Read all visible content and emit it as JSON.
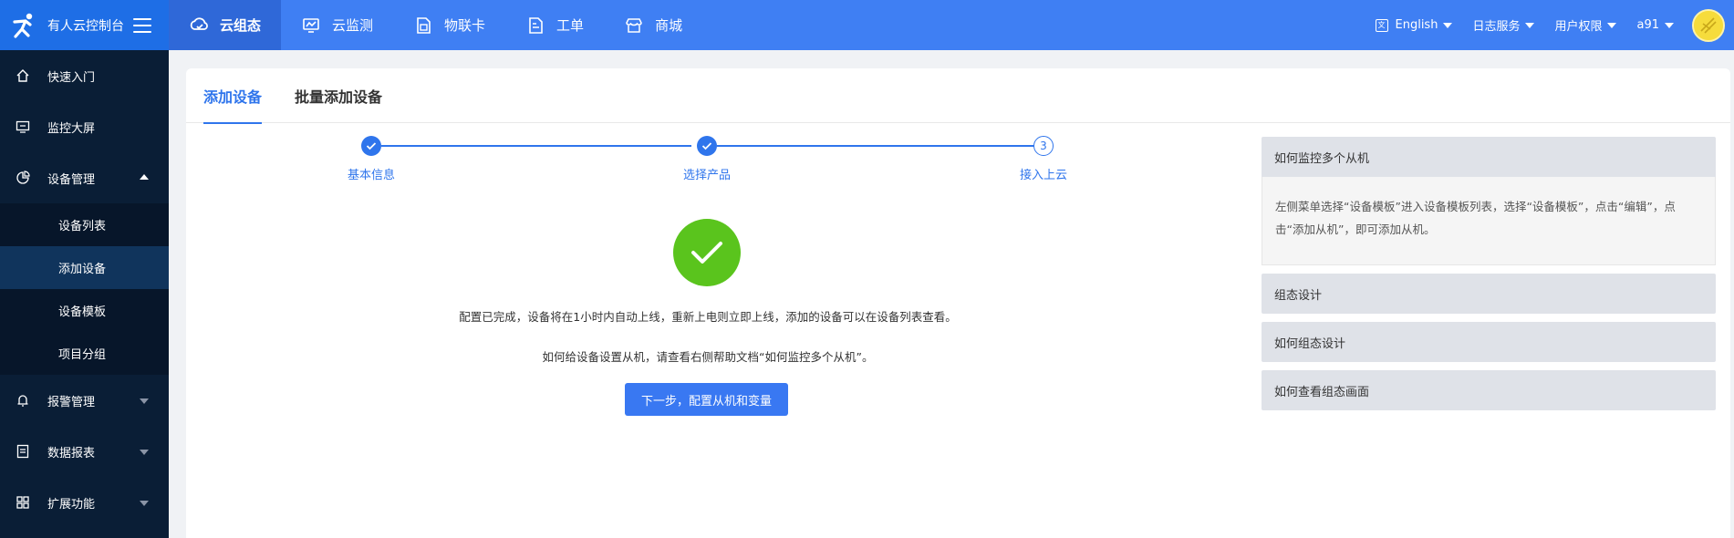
{
  "app": {
    "title": "有人云控制台"
  },
  "topnav": [
    {
      "label": "云组态",
      "icon": "cloud-icon",
      "active": true
    },
    {
      "label": "云监测",
      "icon": "monitor-chart-icon",
      "active": false
    },
    {
      "label": "物联卡",
      "icon": "sim-card-icon",
      "active": false
    },
    {
      "label": "工单",
      "icon": "ticket-icon",
      "active": false
    },
    {
      "label": "商城",
      "icon": "shop-icon",
      "active": false
    }
  ],
  "topright": {
    "language": "English",
    "log_service": "日志服务",
    "user_permissions": "用户权限",
    "username": "a91"
  },
  "sidebar": {
    "items": [
      {
        "label": "快速入门",
        "icon": "home-icon"
      },
      {
        "label": "监控大屏",
        "icon": "screen-icon"
      },
      {
        "label": "设备管理",
        "icon": "device-icon"
      },
      {
        "label": "报警管理",
        "icon": "bell-icon"
      },
      {
        "label": "数据报表",
        "icon": "report-icon"
      },
      {
        "label": "扩展功能",
        "icon": "grid-icon"
      }
    ],
    "sub_items": [
      "设备列表",
      "添加设备",
      "设备模板",
      "项目分组"
    ],
    "active_sub": "添加设备"
  },
  "tabs": [
    "添加设备",
    "批量添加设备"
  ],
  "steps": [
    {
      "label": "基本信息",
      "state": "done"
    },
    {
      "label": "选择产品",
      "state": "done"
    },
    {
      "label": "接入上云",
      "state": "current",
      "number": "3"
    }
  ],
  "result": {
    "message": "配置已完成，设备将在1小时内自动上线，重新上电则立即上线，添加的设备可以在设备列表查看。",
    "hint": "如何给设备设置从机，请查看右侧帮助文档“如何监控多个从机”。",
    "next_button": "下一步，配置从机和变量"
  },
  "help": [
    {
      "title": "如何监控多个从机",
      "expanded": true,
      "body": "左侧菜单选择“设备模板”进入设备模板列表，选择“设备模板”，点击“编辑”，点击“添加从机”，即可添加从机。"
    },
    {
      "title": "组态设计",
      "expanded": false
    },
    {
      "title": "如何组态设计",
      "expanded": false
    },
    {
      "title": "如何查看组态画面",
      "expanded": false
    }
  ],
  "colors": {
    "primary": "#3f7ff3",
    "sidebar": "#0a1e36",
    "success": "#5ac41d"
  }
}
